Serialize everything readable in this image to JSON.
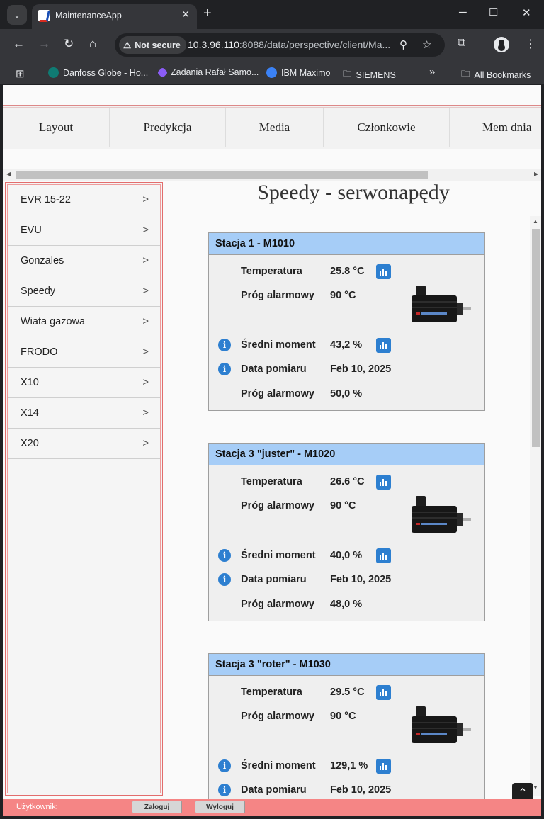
{
  "browser": {
    "tab_title": "MaintenanceApp",
    "tab_close": "✕",
    "new_tab": "+",
    "security_label": "Not secure",
    "url_host": "10.3.96.110",
    "url_rest": ":8088/data/perspective/client/Ma...",
    "bookmarks": [
      {
        "label": "Danfoss Globe - Ho...",
        "color": "#0f7b73"
      },
      {
        "label": "Zadania Rafał Samo...",
        "color": "#8b5cf6"
      },
      {
        "label": "IBM Maximo",
        "color": "#3b82f6"
      },
      {
        "label": "SIEMENS",
        "color": ""
      }
    ],
    "bookmarks_overflow": "»",
    "all_bookmarks": "All Bookmarks"
  },
  "menu": [
    "Layout",
    "Predykcja",
    "Media",
    "Członkowie",
    "Mem dnia"
  ],
  "sidebar": [
    {
      "label": "EVR 15-22"
    },
    {
      "label": "EVU"
    },
    {
      "label": "Gonzales"
    },
    {
      "label": "Speedy"
    },
    {
      "label": "Wiata gazowa"
    },
    {
      "label": "FRODO"
    },
    {
      "label": "X10"
    },
    {
      "label": "X14"
    },
    {
      "label": "X20"
    }
  ],
  "main": {
    "title": "Speedy - serwonapędy",
    "stations": [
      {
        "name": "Stacja 1 - M1010",
        "temperature_label": "Temperatura",
        "temperature": "25.8 °C",
        "alarm_temp_label": "Próg alarmowy",
        "alarm_temp": "90 °C",
        "torque_label": "Średni moment",
        "torque": "43,2 %",
        "date_label": "Data pomiaru",
        "date": "Feb 10, 2025",
        "alarm_torque_label": "Próg alarmowy",
        "alarm_torque": "50,0 %"
      },
      {
        "name": "Stacja 3 \"juster\" - M1020",
        "temperature_label": "Temperatura",
        "temperature": "26.6 °C",
        "alarm_temp_label": "Próg alarmowy",
        "alarm_temp": "90 °C",
        "torque_label": "Średni moment",
        "torque": "40,0 %",
        "date_label": "Data pomiaru",
        "date": "Feb 10, 2025",
        "alarm_torque_label": "Próg alarmowy",
        "alarm_torque": "48,0 %"
      },
      {
        "name": "Stacja 3 \"roter\" - M1030",
        "temperature_label": "Temperatura",
        "temperature": "29.5 °C",
        "alarm_temp_label": "Próg alarmowy",
        "alarm_temp": "90 °C",
        "torque_label": "Średni moment",
        "torque": "129,1 %",
        "date_label": "Data pomiaru",
        "date": "Feb 10, 2025"
      }
    ]
  },
  "footer": {
    "user_label": "Użytkownik:",
    "login": "Zaloguj",
    "logout": "Wyloguj"
  }
}
